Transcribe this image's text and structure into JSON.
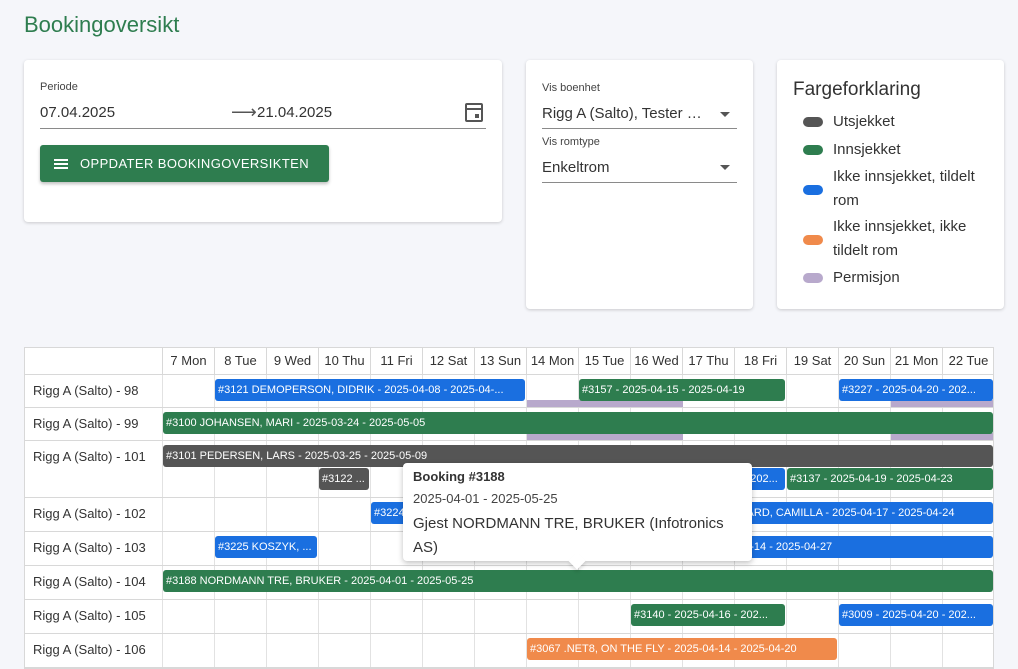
{
  "page": {
    "title": "Bookingoversikt"
  },
  "periode": {
    "label": "Periode",
    "from": "07.04.2025",
    "to": "21.04.2025",
    "update_label": "OPPDATER BOOKINGOVERSIKTEN"
  },
  "vis": {
    "boenhet_label": "Vis boenhet",
    "boenhet_value": "Rigg A (Salto), Tester …",
    "romtype_label": "Vis romtype",
    "romtype_value": "Enkeltrom"
  },
  "legend": {
    "title": "Fargeforklaring",
    "items": [
      {
        "label": "Utsjekket",
        "color": "#555555"
      },
      {
        "label": "Innsjekket",
        "color": "#2e7d4f"
      },
      {
        "label": "Ikke innsjekket, tildelt rom",
        "color": "#1a6fe0"
      },
      {
        "label": "Ikke innsjekket, ikke tildelt rom",
        "color": "#f08a4b"
      },
      {
        "label": "Permisjon",
        "color": "#b8a9cc"
      }
    ]
  },
  "days": [
    "7 Mon",
    "8 Tue",
    "9 Wed",
    "10 Thu",
    "11 Fri",
    "12 Sat",
    "13 Sun",
    "14 Mon",
    "15 Tue",
    "16 Wed",
    "17 Thu",
    "18 Fri",
    "19 Sat",
    "20 Sun",
    "21 Mon",
    "22 Tue"
  ],
  "rows": [
    "Rigg A (Salto) - 98",
    "Rigg A (Salto) - 99",
    "Rigg A (Salto) - 101",
    "Rigg A (Salto) - 102",
    "Rigg A (Salto) - 103",
    "Rigg A (Salto) - 104",
    "Rigg A (Salto) - 105",
    "Rigg A (Salto) - 106"
  ],
  "bookings": [
    {
      "row": 0,
      "start": 1,
      "end": 7,
      "sub": 0,
      "status": "blue",
      "text": "#3121 DEMOPERSON, DIDRIK - 2025-04-08 - 2025-04-..."
    },
    {
      "row": 0,
      "start": 8,
      "end": 12,
      "sub": 0,
      "status": "green",
      "text": "#3157 - 2025-04-15 - 2025-04-19"
    },
    {
      "row": 0,
      "start": 13,
      "end": 16,
      "sub": 0,
      "status": "blue",
      "text": "#3227 - 2025-04-20 - 202..."
    },
    {
      "row": 1,
      "start": 0,
      "end": 16,
      "sub": 0,
      "status": "green",
      "text": "#3100 JOHANSEN, MARI - 2025-03-24 - 2025-05-05"
    },
    {
      "row": 2,
      "start": 0,
      "end": 16,
      "sub": 0,
      "status": "grey",
      "text": "#3101 PEDERSEN, LARS - 2025-03-25 - 2025-05-09"
    },
    {
      "row": 2,
      "start": 3,
      "end": 4,
      "sub": 1,
      "status": "grey",
      "text": "#3122 ..."
    },
    {
      "row": 2,
      "start": 11,
      "end": 12,
      "sub": 1,
      "status": "blue",
      "text": "#3202..."
    },
    {
      "row": 2,
      "start": 12,
      "end": 16,
      "sub": 1,
      "status": "green",
      "text": "#3137 - 2025-04-19 - 2025-04-23"
    },
    {
      "row": 3,
      "start": 4,
      "end": 11,
      "sub": 0,
      "status": "blue",
      "text": "#3224"
    },
    {
      "row": 3,
      "start": 11,
      "end": 16,
      "sub": 0,
      "status": "blue",
      "text": "GÅRD, CAMILLA - 2025-04-17 - 2025-04-24"
    },
    {
      "row": 4,
      "start": 1,
      "end": 3,
      "sub": 0,
      "status": "blue",
      "text": "#3225 KOSZYK, ..."
    },
    {
      "row": 4,
      "start": 11,
      "end": 16,
      "sub": 0,
      "status": "blue",
      "text": "04-14 - 2025-04-27"
    },
    {
      "row": 5,
      "start": 0,
      "end": 16,
      "sub": 0,
      "status": "green",
      "text": "#3188 NORDMANN TRE, BRUKER - 2025-04-01 - 2025-05-25"
    },
    {
      "row": 6,
      "start": 9,
      "end": 12,
      "sub": 0,
      "status": "green",
      "text": "#3140 - 2025-04-16 - 202..."
    },
    {
      "row": 6,
      "start": 13,
      "end": 16,
      "sub": 0,
      "status": "blue",
      "text": "#3009 - 2025-04-20 - 202..."
    },
    {
      "row": 7,
      "start": 7,
      "end": 13,
      "sub": 0,
      "status": "orange",
      "text": "#3067 .NET8, ON THE FLY - 2025-04-14 - 2025-04-20"
    }
  ],
  "permisjon": [
    {
      "row": 0,
      "start": 7,
      "end": 10
    },
    {
      "row": 0,
      "start": 14,
      "end": 16
    },
    {
      "row": 1,
      "start": 7,
      "end": 10
    },
    {
      "row": 1,
      "start": 14,
      "end": 16
    }
  ],
  "status_colors": {
    "grey": "#555555",
    "green": "#2e7d4f",
    "blue": "#1a6fe0",
    "orange": "#f08a4b"
  },
  "tooltip": {
    "title": "Booking #3188",
    "dates": "2025-04-01 - 2025-05-25",
    "guest": "Gjest NORDMANN TRE, BRUKER (Infotronics AS)"
  }
}
